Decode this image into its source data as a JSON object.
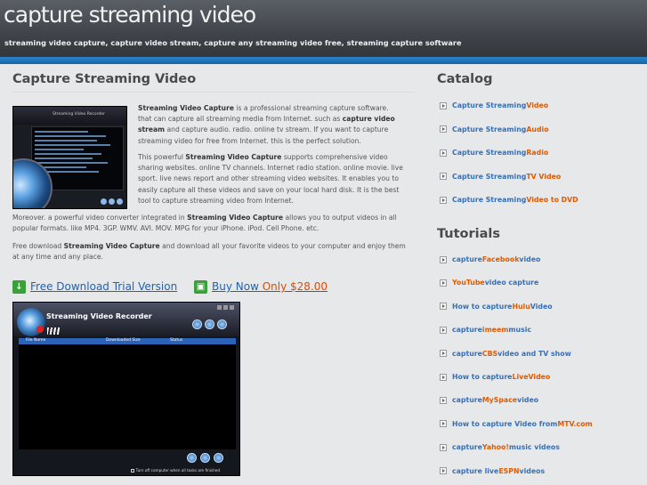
{
  "header": {
    "title": "capture streaming video",
    "tagline": "streaming video capture, capture video stream, capture any streaming video free, streaming capture software"
  },
  "main": {
    "title": "Capture Streaming Video",
    "thumb_title": "Streaming Video Recorder",
    "p1": {
      "b1": "Streaming Video Capture",
      "t1": " is a professional streaming capture software. that can capture all streaming media from Internet. such as ",
      "b2": "capture video stream",
      "t2": " and capture audio. radio. online tv stream. If you want to capture streaming video for free from Internet. this is the perfect solution."
    },
    "p2": {
      "t1": "This powerful ",
      "b1": "Streaming Video Capture",
      "t2": " supports comprehensive video sharing websites. online TV channels. Internet radio station. online movie. live sport. live news report and other streaming video websites. It enables you to easily capture all these videos and save on your local hard disk. It is the best tool to capture streaming video from Internet."
    },
    "p3": {
      "t1": "Moreover. a powerful video converter integrated in ",
      "b1": "Streaming Video Capture",
      "t2": " allows you to output videos in all popular formats. like MP4. 3GP. WMV. AVI. MOV. MPG for your iPhone. iPod. Cell Phone. etc."
    },
    "p4": {
      "t1": "Free download ",
      "b1": "Streaming Video Capture",
      "t2": " and download all your favorite videos to your computer and enjoy them at any time and any place."
    },
    "free_download": "Free Download Trial Version",
    "buy_now": "Buy Now ",
    "buy_price": "Only $28.00",
    "screenshot": {
      "title": "Streaming Video Recorder",
      "col_name": "File Name",
      "col_size": "Downloaded Size",
      "col_status": "Status",
      "checkbox_label": "Turn off computer when all tasks are finished"
    }
  },
  "sidebar": {
    "catalog_title": "Catalog",
    "catalog": [
      [
        {
          "t": "Capture Streaming ",
          "h": false
        },
        {
          "t": "Video",
          "h": true
        }
      ],
      [
        {
          "t": "Capture Streaming ",
          "h": false
        },
        {
          "t": "Audio",
          "h": true
        }
      ],
      [
        {
          "t": "Capture Streaming ",
          "h": false
        },
        {
          "t": "Radio",
          "h": true
        }
      ],
      [
        {
          "t": "Capture Streaming ",
          "h": false
        },
        {
          "t": "TV Video",
          "h": true
        }
      ],
      [
        {
          "t": "Capture Streaming ",
          "h": false
        },
        {
          "t": "Video to DVD",
          "h": true
        }
      ]
    ],
    "tutorials_title": "Tutorials",
    "tutorials": [
      [
        {
          "t": "capture ",
          "h": false
        },
        {
          "t": "Facebook",
          "h": true
        },
        {
          "t": " video",
          "h": false
        }
      ],
      [
        {
          "t": "YouTube",
          "h": true
        },
        {
          "t": " video capture",
          "h": false
        }
      ],
      [
        {
          "t": "How to capture ",
          "h": false
        },
        {
          "t": "Hulu",
          "h": true
        },
        {
          "t": " Video",
          "h": false
        }
      ],
      [
        {
          "t": "capture ",
          "h": false
        },
        {
          "t": "imeem",
          "h": true
        },
        {
          "t": " music",
          "h": false
        }
      ],
      [
        {
          "t": "capture ",
          "h": false
        },
        {
          "t": "CBS",
          "h": true
        },
        {
          "t": " video and TV show",
          "h": false
        }
      ],
      [
        {
          "t": "How to capture ",
          "h": false
        },
        {
          "t": "LiveVideo",
          "h": true
        }
      ],
      [
        {
          "t": "capture ",
          "h": false
        },
        {
          "t": "MySpace",
          "h": true
        },
        {
          "t": " video",
          "h": false
        }
      ],
      [
        {
          "t": "How to capture Video from ",
          "h": false
        },
        {
          "t": "MTV.com",
          "h": true
        }
      ],
      [
        {
          "t": "capture ",
          "h": false
        },
        {
          "t": "Yahoo!",
          "h": true
        },
        {
          "t": " music videos",
          "h": false
        }
      ],
      [
        {
          "t": "capture live ",
          "h": false
        },
        {
          "t": "ESPN",
          "h": true
        },
        {
          "t": " videos",
          "h": false
        }
      ]
    ]
  }
}
